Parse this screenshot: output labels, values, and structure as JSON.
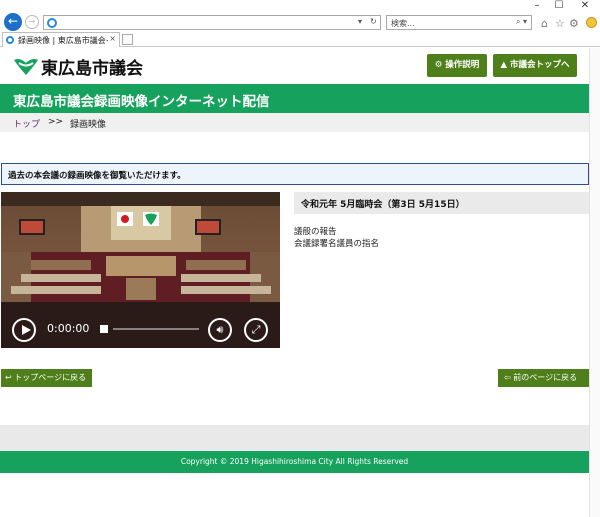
{
  "browser": {
    "tab_title": "録画映像 | 東広島市議会イ...",
    "search_placeholder": "検索...",
    "tab_close": "×",
    "window_controls": {
      "minimize": "–",
      "maximize": "☐",
      "close": "✕"
    },
    "icons": [
      "back-arrow-icon",
      "forward-arrow-icon",
      "ie-icon",
      "search-icon",
      "refresh-icon",
      "home-icon",
      "star-icon",
      "gear-icon",
      "smiley-icon"
    ]
  },
  "site": {
    "logo_text": "東広島市議会",
    "buttons": {
      "manual": "操作説明",
      "council_top": "市議会トップへ"
    },
    "banner_title": "東広島市議会録画映像インターネット配信",
    "breadcrumb": {
      "home": "トップ",
      "sep": ">>",
      "current": "録画映像"
    },
    "notice": "過去の本会議の録画映像を御覧いただけます。",
    "player": {
      "time": "0:00:00"
    },
    "meeting": {
      "title": "令和元年 5月臨時会（第3日 5月15日）",
      "agenda": [
        "議般の報告",
        "会議録署名議員の指名"
      ]
    },
    "nav": {
      "back_top": "トップページに戻る",
      "back_prev": "前のページに戻る"
    },
    "footer": "Copyright © 2019 Higashihiroshima City All Rights Reserved"
  },
  "colors": {
    "green": "#16a15c",
    "dark_green": "#4f7f1b",
    "notice_border": "#2c4f9a",
    "ie_blue": "#1d6fc9"
  }
}
